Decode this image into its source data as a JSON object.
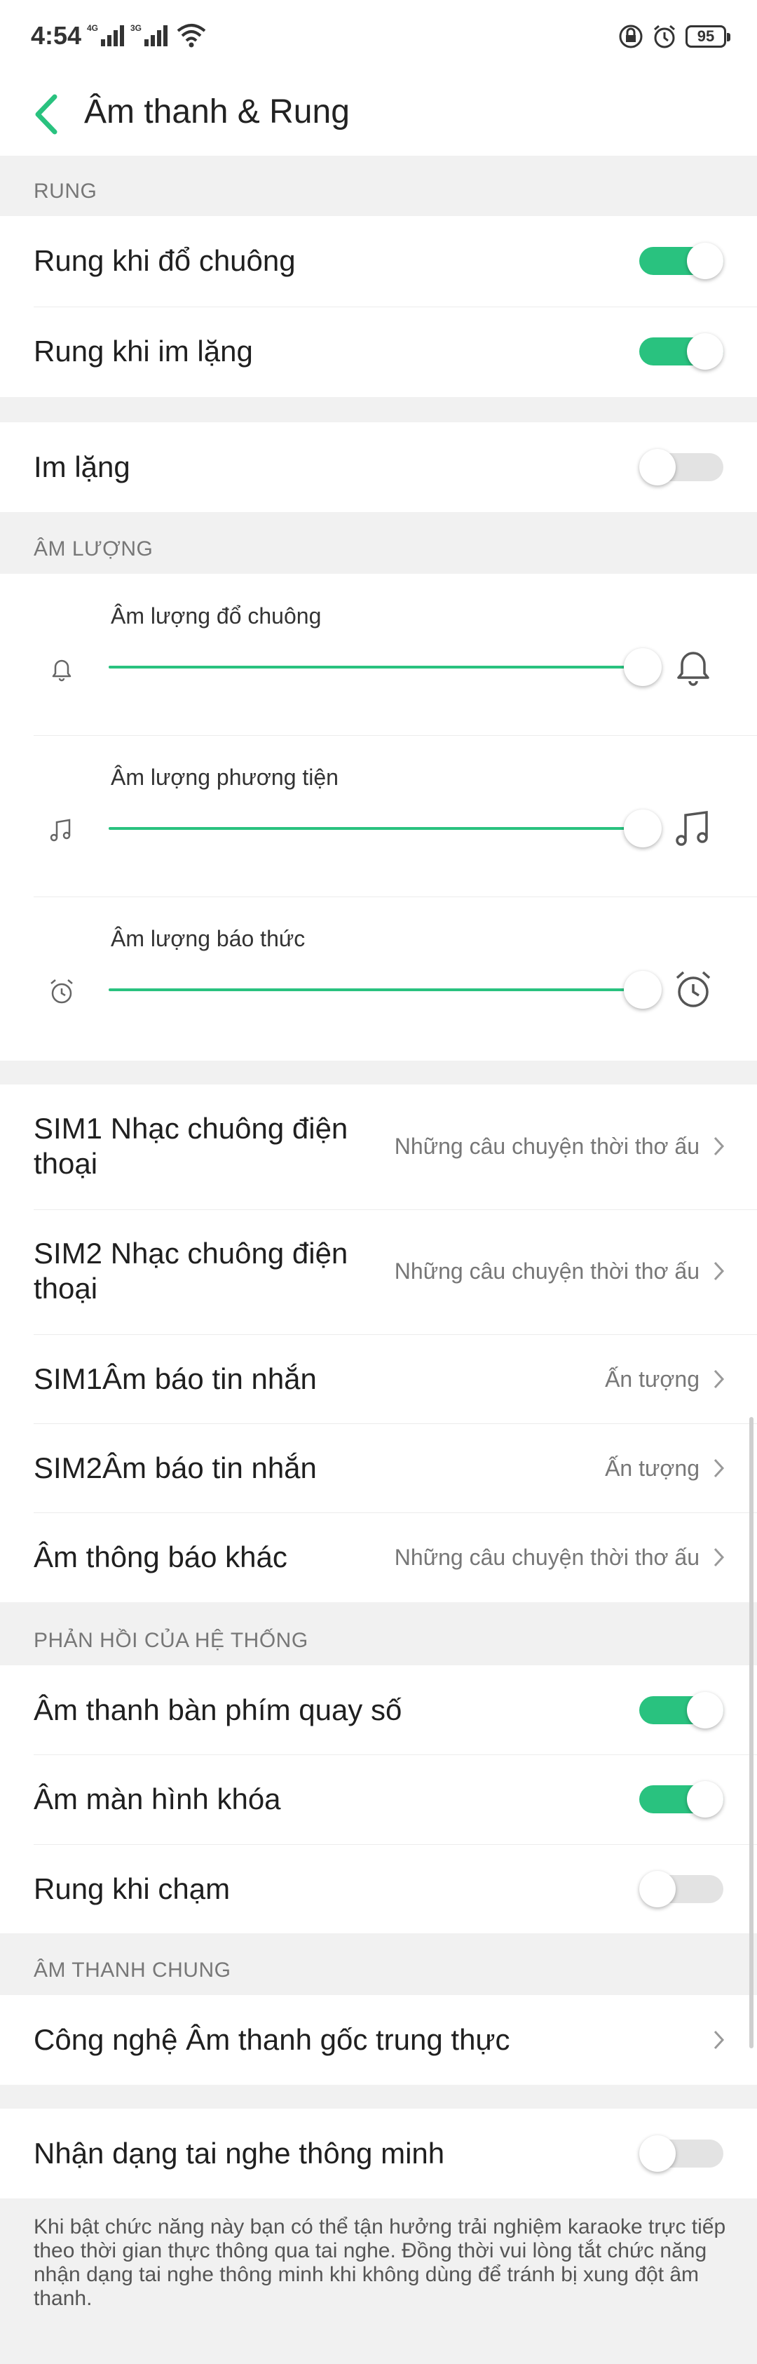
{
  "status_bar": {
    "time": "4:54",
    "signal1": "4G",
    "signal2": "3G",
    "battery": "95"
  },
  "header": {
    "title": "Âm thanh & Rung"
  },
  "sections": {
    "vibrate": "RUNG",
    "volume": "ÂM LƯỢNG",
    "feedback": "PHẢN HỒI CỦA HỆ THỐNG",
    "general": "ÂM THANH CHUNG"
  },
  "vibrate": {
    "ring_label": "Rung khi đổ chuông",
    "ring_on": true,
    "silent_label": "Rung khi im lặng",
    "silent_on": true
  },
  "silent": {
    "label": "Im lặng",
    "on": false
  },
  "volume": {
    "ringtone_label": "Âm lượng đổ chuông",
    "ringtone_level": 1.0,
    "media_label": "Âm lượng phương tiện",
    "media_level": 1.0,
    "alarm_label": "Âm lượng báo thức",
    "alarm_level": 1.0
  },
  "tones": {
    "sim1_ringtone_label": "SIM1 Nhạc chuông điện thoại",
    "sim1_ringtone_value": "Những câu chuyện thời thơ ấu",
    "sim2_ringtone_label": "SIM2 Nhạc chuông điện thoại",
    "sim2_ringtone_value": "Những câu chuyện thời thơ ấu",
    "sim1_message_label": "SIM1Âm báo tin nhắn",
    "sim1_message_value": "Ấn tượng",
    "sim2_message_label": "SIM2Âm báo tin nhắn",
    "sim2_message_value": "Ấn tượng",
    "other_label": "Âm thông báo khác",
    "other_value": "Những câu chuyện thời thơ ấu"
  },
  "feedback": {
    "dialpad_label": "Âm thanh bàn phím quay số",
    "dialpad_on": true,
    "lock_label": "Âm màn hình khóa",
    "lock_on": true,
    "touch_label": "Rung khi chạm",
    "touch_on": false
  },
  "general": {
    "hifi_label": "Công nghệ Âm thanh gốc trung thực"
  },
  "headset": {
    "label": "Nhận dạng tai nghe thông minh",
    "on": false,
    "note": "Khi bật chức năng này bạn có thể tận hưởng trải nghiệm karaoke trực tiếp theo thời gian thực thông qua tai nghe. Đồng thời vui lòng tắt chức năng nhận dạng tai nghe thông minh khi không dùng để tránh bị xung đột âm thanh."
  },
  "colors": {
    "accent": "#29c27f",
    "switch_off": "#e3e3e3",
    "background": "#f1f1f1"
  }
}
